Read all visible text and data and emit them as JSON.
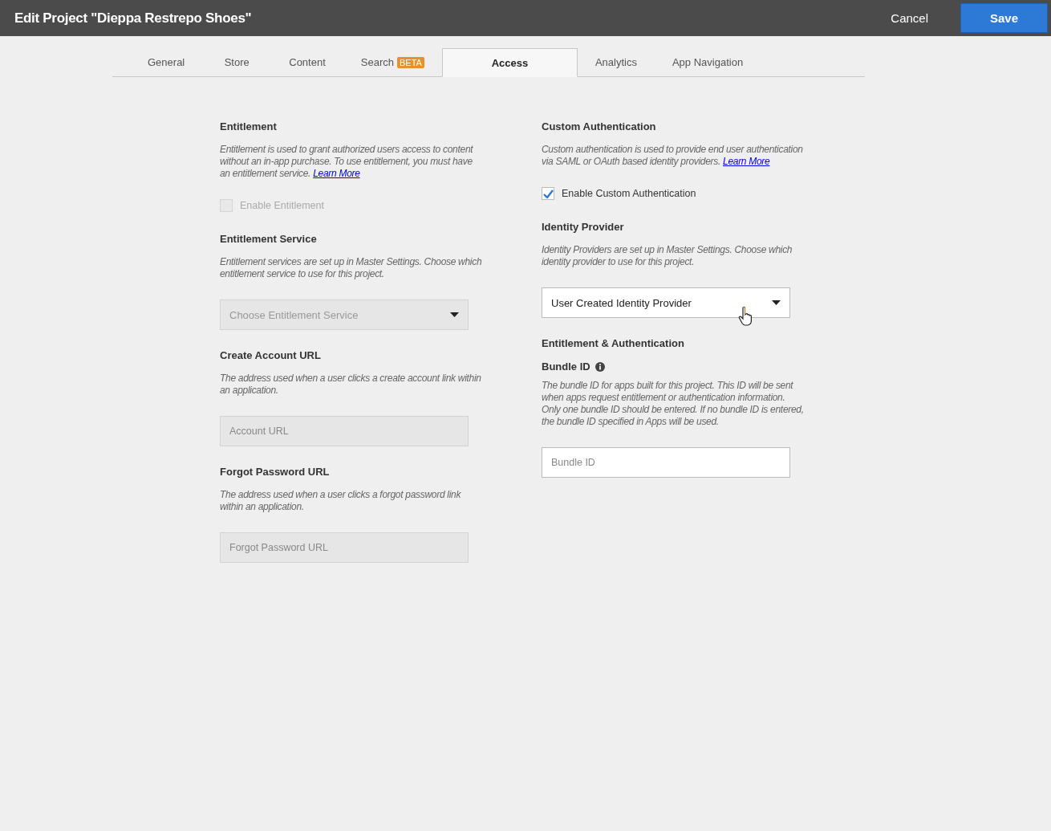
{
  "window": {
    "title": "Edit Project \"Dieppa Restrepo Shoes\""
  },
  "header_buttons": {
    "cancel": "Cancel",
    "save": "Save"
  },
  "tabs": [
    {
      "label": "General",
      "selected": false
    },
    {
      "label": "Store",
      "selected": false
    },
    {
      "label": "Content",
      "selected": false
    },
    {
      "label": "Search",
      "badge": "BETA",
      "selected": false
    },
    {
      "label": "Access",
      "selected": true
    },
    {
      "label": "Analytics",
      "selected": false
    },
    {
      "label": "App Navigation",
      "selected": false
    }
  ],
  "columns": [
    {
      "items": [
        {
          "kind": "heading",
          "text": "Entitlement"
        },
        {
          "kind": "description",
          "text": "Entitlement is used to grant authorized users access to content without an  in-app purchase. To use  entitlement, you must have an entitlement service.",
          "link": "Learn More"
        },
        {
          "kind": "checkbox",
          "label": "Enable Entitlement",
          "checked": false,
          "disabled": true
        },
        {
          "kind": "heading",
          "text": "Entitlement Service"
        },
        {
          "kind": "description",
          "text": "Entitlement services are set up in Master Settings. Choose which entitlement service to use for this  project."
        },
        {
          "kind": "dropdown",
          "placeholder": "Choose Entitlement Service",
          "disabled": true
        },
        {
          "kind": "heading",
          "text": "Create Account URL"
        },
        {
          "kind": "description",
          "text": "The address used when a user clicks a create account link within an application."
        },
        {
          "kind": "input",
          "placeholder": "Account URL",
          "disabled": true
        },
        {
          "kind": "heading",
          "text": "Forgot Password URL"
        },
        {
          "kind": "description",
          "text": "The address used when a user clicks a forgot password link within an application."
        },
        {
          "kind": "input",
          "placeholder": "Forgot Password URL",
          "disabled": true
        }
      ]
    },
    {
      "items": [
        {
          "kind": "heading",
          "text": "Custom Authentication"
        },
        {
          "kind": "description",
          "text": "Custom authentication is used to provide end user authentication via SAML or OAuth based identity providers.",
          "link": "Learn More"
        },
        {
          "kind": "checkbox",
          "label": "Enable Custom Authentication",
          "checked": true,
          "disabled": false
        },
        {
          "kind": "heading",
          "text": "Identity Provider"
        },
        {
          "kind": "description",
          "text": "Identity Providers are set up in Master Settings.  Choose which identity provider to use for this project."
        },
        {
          "kind": "dropdown",
          "value": "User Created Identity Provider",
          "disabled": false
        },
        {
          "kind": "heading",
          "text": "Entitlement & Authentication"
        },
        {
          "kind": "label_info",
          "text": "Bundle ID"
        },
        {
          "kind": "description",
          "text": "The bundle ID for apps built for this project. This ID will be sent when apps request entitlement or authentication information. Only one bundle ID should be entered. If no bundle ID is entered, the bundle ID specified in Apps will be used."
        },
        {
          "kind": "input",
          "placeholder": "Bundle ID",
          "disabled": false
        }
      ]
    }
  ]
}
